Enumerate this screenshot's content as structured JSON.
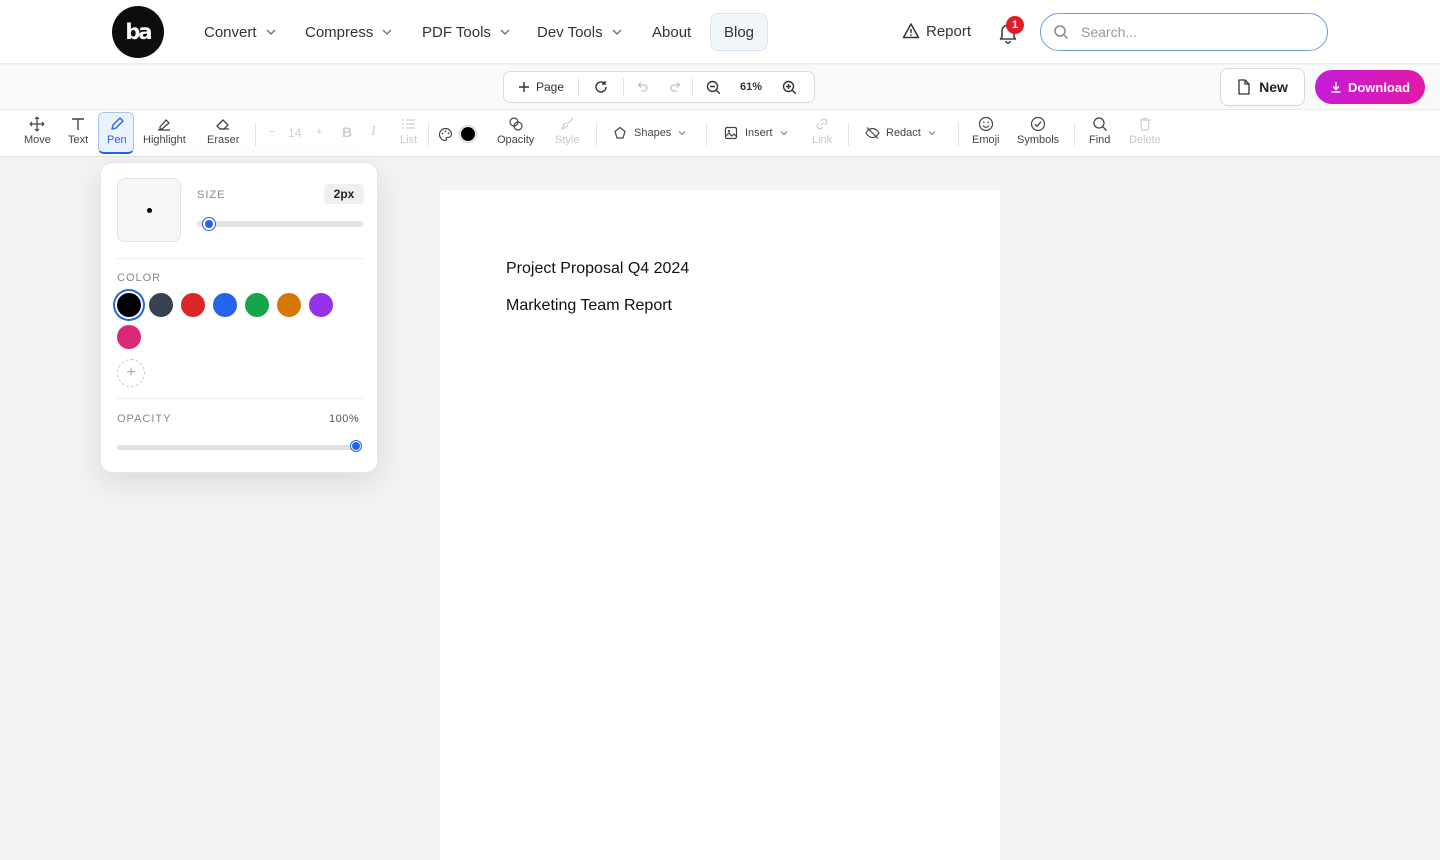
{
  "nav": {
    "logo_text": "ba",
    "items": [
      {
        "label": "Convert"
      },
      {
        "label": "Compress"
      },
      {
        "label": "PDF Tools"
      },
      {
        "label": "Dev Tools"
      },
      {
        "label": "About"
      },
      {
        "label": "Blog"
      }
    ],
    "report_label": "Report",
    "notification_count": "1",
    "search_placeholder": "Search..."
  },
  "page_controls": {
    "add_page_label": "Page",
    "zoom": "61%"
  },
  "actions": {
    "new_label": "New",
    "download_label": "Download"
  },
  "toolbar": {
    "move": "Move",
    "text": "Text",
    "pen": "Pen",
    "highlight": "Highlight",
    "eraser": "Eraser",
    "font_size": "14",
    "list": "List",
    "opacity": "Opacity",
    "style": "Style",
    "shapes": "Shapes",
    "insert": "Insert",
    "link": "Link",
    "redact": "Redact",
    "emoji": "Emoji",
    "symbols": "Symbols",
    "find": "Find",
    "delete": "Delete",
    "current_color": "#000000"
  },
  "document": {
    "lines": [
      "Project Proposal Q4 2024",
      "Marketing Team Report"
    ]
  },
  "pen_panel": {
    "size_label": "SIZE",
    "size_value": "2px",
    "size_fraction": 0.04,
    "color_label": "COLOR",
    "colors": [
      "#000000",
      "#374151",
      "#dc2626",
      "#2563eb",
      "#16a34a",
      "#d97706",
      "#9333ea",
      "#db2777"
    ],
    "selected_color": "#000000",
    "opacity_label": "OPACITY",
    "opacity_value": "100%",
    "opacity_fraction": 1.0
  }
}
